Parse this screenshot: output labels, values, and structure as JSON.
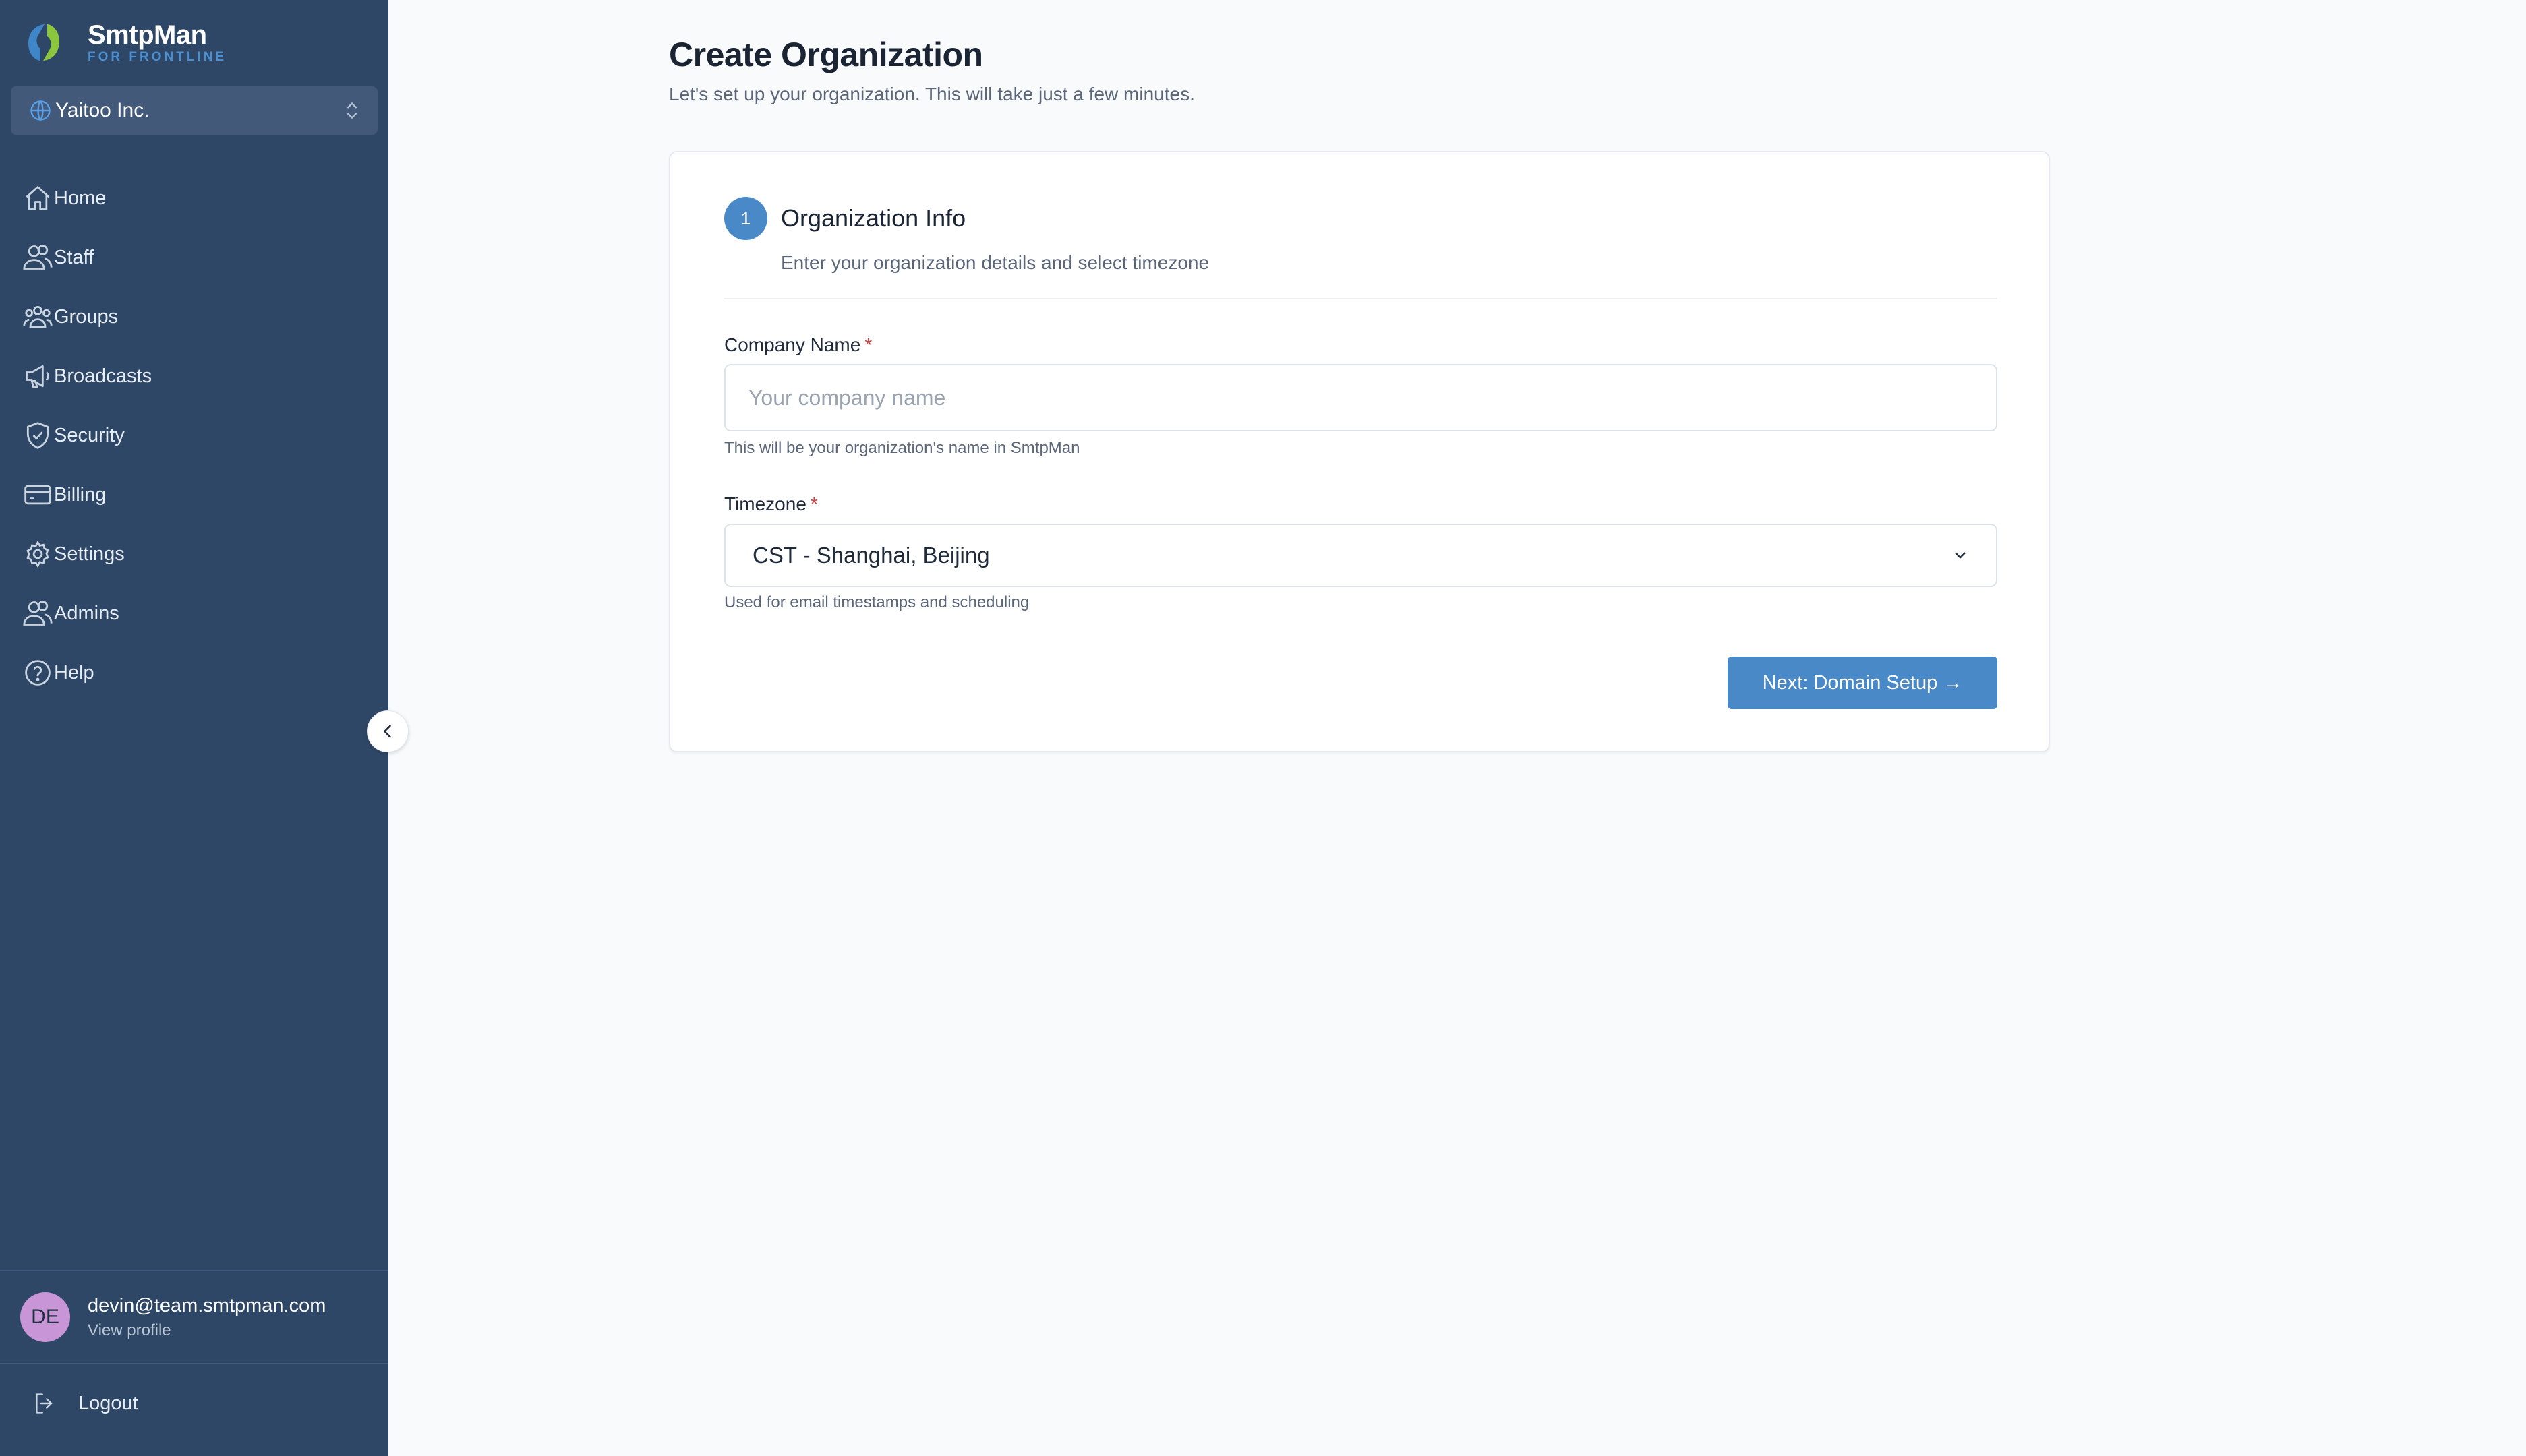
{
  "app": {
    "name": "SmtpMan",
    "tagline": "FOR FRONTLINE",
    "brand_colors": {
      "sidebar": "#2f4766",
      "accent": "#4a89c8",
      "avatar": "#c896d6"
    }
  },
  "org_switcher": {
    "selected": "Yaitoo Inc.",
    "icon": "globe-icon"
  },
  "sidebar": {
    "items": [
      {
        "label": "Home",
        "icon": "home-icon"
      },
      {
        "label": "Staff",
        "icon": "users-icon"
      },
      {
        "label": "Groups",
        "icon": "groups-icon"
      },
      {
        "label": "Broadcasts",
        "icon": "megaphone-icon"
      },
      {
        "label": "Security",
        "icon": "shield-check-icon"
      },
      {
        "label": "Billing",
        "icon": "credit-card-icon"
      },
      {
        "label": "Settings",
        "icon": "gear-icon"
      },
      {
        "label": "Admins",
        "icon": "users-icon"
      },
      {
        "label": "Help",
        "icon": "help-circle-icon"
      }
    ]
  },
  "user": {
    "initials": "DE",
    "email": "devin@team.smtpman.com",
    "profile_link": "View profile"
  },
  "logout": {
    "label": "Logout"
  },
  "page": {
    "title": "Create Organization",
    "subtitle": "Let's set up your organization. This will take just a few minutes."
  },
  "step": {
    "number": "1",
    "title": "Organization Info",
    "description": "Enter your organization details and select timezone"
  },
  "form": {
    "company_name": {
      "label": "Company Name",
      "required_mark": "*",
      "value": "",
      "placeholder": "Your company name",
      "hint": "This will be your organization's name in SmtpMan"
    },
    "timezone": {
      "label": "Timezone",
      "required_mark": "*",
      "selected": "CST - Shanghai, Beijing",
      "hint": "Used for email timestamps and scheduling"
    },
    "next_button": "Next: Domain Setup →"
  }
}
